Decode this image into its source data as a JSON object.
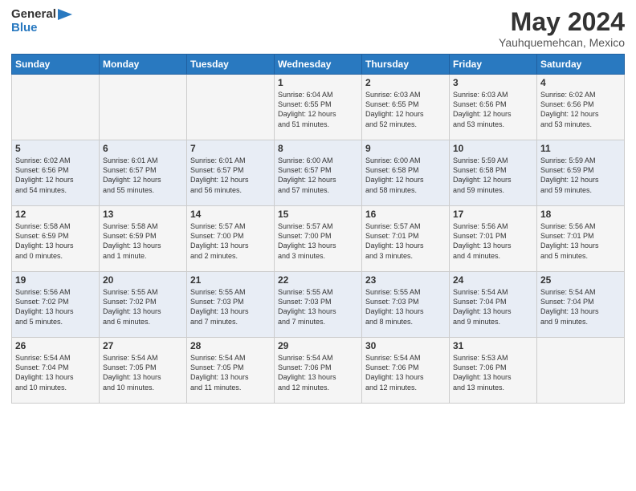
{
  "logo": {
    "line1": "General",
    "line2": "Blue"
  },
  "title": "May 2024",
  "subtitle": "Yauhquemehcan, Mexico",
  "headers": [
    "Sunday",
    "Monday",
    "Tuesday",
    "Wednesday",
    "Thursday",
    "Friday",
    "Saturday"
  ],
  "weeks": [
    [
      {
        "day": "",
        "info": ""
      },
      {
        "day": "",
        "info": ""
      },
      {
        "day": "",
        "info": ""
      },
      {
        "day": "1",
        "info": "Sunrise: 6:04 AM\nSunset: 6:55 PM\nDaylight: 12 hours\nand 51 minutes."
      },
      {
        "day": "2",
        "info": "Sunrise: 6:03 AM\nSunset: 6:55 PM\nDaylight: 12 hours\nand 52 minutes."
      },
      {
        "day": "3",
        "info": "Sunrise: 6:03 AM\nSunset: 6:56 PM\nDaylight: 12 hours\nand 53 minutes."
      },
      {
        "day": "4",
        "info": "Sunrise: 6:02 AM\nSunset: 6:56 PM\nDaylight: 12 hours\nand 53 minutes."
      }
    ],
    [
      {
        "day": "5",
        "info": "Sunrise: 6:02 AM\nSunset: 6:56 PM\nDaylight: 12 hours\nand 54 minutes."
      },
      {
        "day": "6",
        "info": "Sunrise: 6:01 AM\nSunset: 6:57 PM\nDaylight: 12 hours\nand 55 minutes."
      },
      {
        "day": "7",
        "info": "Sunrise: 6:01 AM\nSunset: 6:57 PM\nDaylight: 12 hours\nand 56 minutes."
      },
      {
        "day": "8",
        "info": "Sunrise: 6:00 AM\nSunset: 6:57 PM\nDaylight: 12 hours\nand 57 minutes."
      },
      {
        "day": "9",
        "info": "Sunrise: 6:00 AM\nSunset: 6:58 PM\nDaylight: 12 hours\nand 58 minutes."
      },
      {
        "day": "10",
        "info": "Sunrise: 5:59 AM\nSunset: 6:58 PM\nDaylight: 12 hours\nand 59 minutes."
      },
      {
        "day": "11",
        "info": "Sunrise: 5:59 AM\nSunset: 6:59 PM\nDaylight: 12 hours\nand 59 minutes."
      }
    ],
    [
      {
        "day": "12",
        "info": "Sunrise: 5:58 AM\nSunset: 6:59 PM\nDaylight: 13 hours\nand 0 minutes."
      },
      {
        "day": "13",
        "info": "Sunrise: 5:58 AM\nSunset: 6:59 PM\nDaylight: 13 hours\nand 1 minute."
      },
      {
        "day": "14",
        "info": "Sunrise: 5:57 AM\nSunset: 7:00 PM\nDaylight: 13 hours\nand 2 minutes."
      },
      {
        "day": "15",
        "info": "Sunrise: 5:57 AM\nSunset: 7:00 PM\nDaylight: 13 hours\nand 3 minutes."
      },
      {
        "day": "16",
        "info": "Sunrise: 5:57 AM\nSunset: 7:01 PM\nDaylight: 13 hours\nand 3 minutes."
      },
      {
        "day": "17",
        "info": "Sunrise: 5:56 AM\nSunset: 7:01 PM\nDaylight: 13 hours\nand 4 minutes."
      },
      {
        "day": "18",
        "info": "Sunrise: 5:56 AM\nSunset: 7:01 PM\nDaylight: 13 hours\nand 5 minutes."
      }
    ],
    [
      {
        "day": "19",
        "info": "Sunrise: 5:56 AM\nSunset: 7:02 PM\nDaylight: 13 hours\nand 5 minutes."
      },
      {
        "day": "20",
        "info": "Sunrise: 5:55 AM\nSunset: 7:02 PM\nDaylight: 13 hours\nand 6 minutes."
      },
      {
        "day": "21",
        "info": "Sunrise: 5:55 AM\nSunset: 7:03 PM\nDaylight: 13 hours\nand 7 minutes."
      },
      {
        "day": "22",
        "info": "Sunrise: 5:55 AM\nSunset: 7:03 PM\nDaylight: 13 hours\nand 7 minutes."
      },
      {
        "day": "23",
        "info": "Sunrise: 5:55 AM\nSunset: 7:03 PM\nDaylight: 13 hours\nand 8 minutes."
      },
      {
        "day": "24",
        "info": "Sunrise: 5:54 AM\nSunset: 7:04 PM\nDaylight: 13 hours\nand 9 minutes."
      },
      {
        "day": "25",
        "info": "Sunrise: 5:54 AM\nSunset: 7:04 PM\nDaylight: 13 hours\nand 9 minutes."
      }
    ],
    [
      {
        "day": "26",
        "info": "Sunrise: 5:54 AM\nSunset: 7:04 PM\nDaylight: 13 hours\nand 10 minutes."
      },
      {
        "day": "27",
        "info": "Sunrise: 5:54 AM\nSunset: 7:05 PM\nDaylight: 13 hours\nand 10 minutes."
      },
      {
        "day": "28",
        "info": "Sunrise: 5:54 AM\nSunset: 7:05 PM\nDaylight: 13 hours\nand 11 minutes."
      },
      {
        "day": "29",
        "info": "Sunrise: 5:54 AM\nSunset: 7:06 PM\nDaylight: 13 hours\nand 12 minutes."
      },
      {
        "day": "30",
        "info": "Sunrise: 5:54 AM\nSunset: 7:06 PM\nDaylight: 13 hours\nand 12 minutes."
      },
      {
        "day": "31",
        "info": "Sunrise: 5:53 AM\nSunset: 7:06 PM\nDaylight: 13 hours\nand 13 minutes."
      },
      {
        "day": "",
        "info": ""
      }
    ]
  ]
}
